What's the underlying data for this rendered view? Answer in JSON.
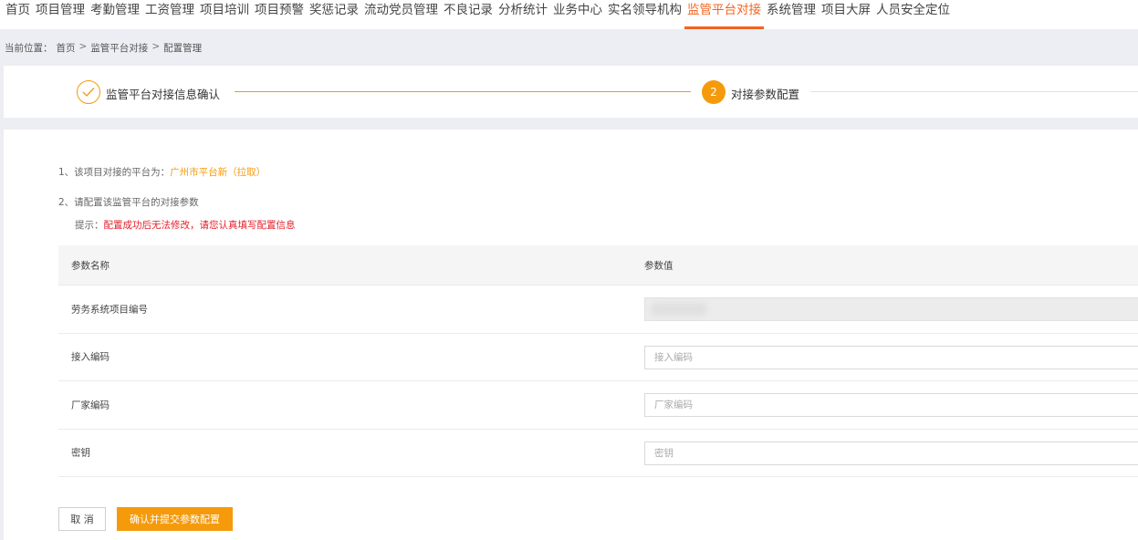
{
  "nav": {
    "items": [
      "首页",
      "项目管理",
      "考勤管理",
      "工资管理",
      "项目培训",
      "项目预警",
      "奖惩记录",
      "流动党员管理",
      "不良记录",
      "分析统计",
      "业务中心",
      "实名领导机构",
      "监管平台对接",
      "系统管理",
      "项目大屏",
      "人员安全定位"
    ],
    "active_index": 12
  },
  "breadcrumb": {
    "prefix": "当前位置：",
    "items": [
      "首页",
      "监管平台对接",
      "配置管理"
    ],
    "separator": ">"
  },
  "steps": {
    "step1": {
      "icon": "check-icon",
      "label": "监管平台对接信息确认"
    },
    "step2": {
      "number": "2",
      "label": "对接参数配置"
    }
  },
  "info": {
    "line1_prefix": "1、该项目对接的平台为：",
    "platform": "广州市平台新（拉取）",
    "line2": "2、请配置该监管平台的对接参数",
    "tip_prefix": "提示：",
    "tip_text": "配置成功后无法修改，请您认真填写配置信息"
  },
  "table": {
    "headers": {
      "name": "参数名称",
      "value": "参数值"
    },
    "rows": [
      {
        "name": "劳务系统项目编号",
        "value": "",
        "placeholder": "",
        "readonly": true
      },
      {
        "name": "接入编码",
        "value": "",
        "placeholder": "接入编码",
        "readonly": false
      },
      {
        "name": "厂家编码",
        "value": "",
        "placeholder": "厂家编码",
        "readonly": false
      },
      {
        "name": "密钥",
        "value": "",
        "placeholder": "密钥",
        "readonly": false
      }
    ]
  },
  "buttons": {
    "cancel": "取 消",
    "submit": "确认并提交参数配置"
  },
  "colors": {
    "accent": "#f59a0b",
    "nav_active": "#f5641e",
    "warning": "#e4202a"
  }
}
